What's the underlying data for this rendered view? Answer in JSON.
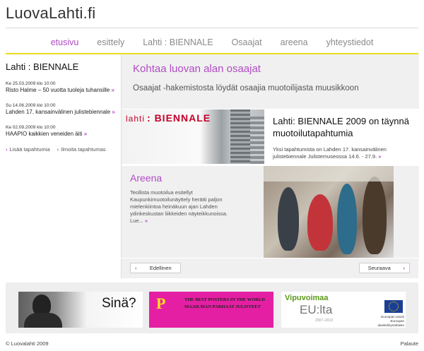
{
  "site": {
    "logo": "LuovaLahti.fi"
  },
  "nav": {
    "items": [
      "etusivu",
      "esittely",
      "Lahti : BIENNALE",
      "Osaajat",
      "areena",
      "yhteystiedot"
    ],
    "active": 0
  },
  "sidebar": {
    "title": "Lahti : BIENNALE",
    "events": [
      {
        "date": "Ke 25.03.2009 klo 10:00",
        "title": "Risto Halme – 50 vuotta tuoleja tuhansille"
      },
      {
        "date": "Su 14.06.2009 klo 10:00",
        "title": "Lahden 17. kansainvälinen julistebiennale"
      },
      {
        "date": "Ke 02.09.2009 klo 10:00",
        "title": "HAAPIO kaikkien veneiden äiti"
      }
    ],
    "links": {
      "more": "Lisää tapahtumia",
      "report": "Ilmoita tapahtumas"
    }
  },
  "hero": {
    "title": "Kohtaa luovan alan osaajat",
    "text": "Osaajat -hakemistosta löydät osaajia muotoilijasta muusikkoon"
  },
  "featured": {
    "image_text": {
      "prefix": "lahti",
      "brand": ": BIENNALE"
    },
    "title": "Lahti: BIENNALE 2009 on täynnä muotoilutapahtumia",
    "text": "Yksi tapahtumista on Lahden 17. kansainvälinen julistebiennale Julistemuseossa 14.6. - 27.9."
  },
  "areena": {
    "title": "Areena",
    "text": "Teollista muotoilua esitellyt Kaupunkimuotoilunäyttely herätti paljon mielenkiintoa heinäkuun ajan Lahden ydinkeskustan liikkeiden näyteikkunoissa. Lue..."
  },
  "pager": {
    "prev": "Edellinen",
    "next": "Seuraava"
  },
  "banners": {
    "b1": {
      "text": "Sinä?"
    },
    "b2": {
      "letter": "P",
      "line1": "THE BEST POSTERS IN THE WORLD",
      "line2": "MAAILMAN PARHAAT JULISTEET"
    },
    "b3": {
      "line1": "Vipuvoimaa",
      "line2": "EU:lta",
      "years": "2007–2013",
      "eu": "Euroopan unioni Euroopan aluekehitysrahasto"
    }
  },
  "footer": {
    "copyright": "© Luovalahti 2009",
    "feedback": "Palaute"
  },
  "colors": {
    "accent": "#b04cc4",
    "rule": "#e8dc1e",
    "brand_red": "#c4002a",
    "banner_pink": "#e41fa3"
  },
  "icons": {
    "arrow": "chevron-right-icon"
  }
}
